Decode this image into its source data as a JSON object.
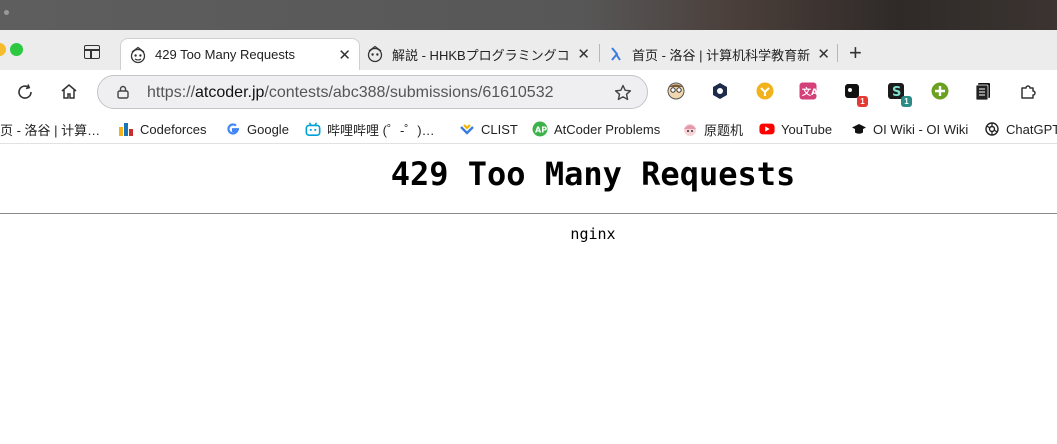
{
  "browser": {
    "tabs": [
      {
        "title": "429 Too Many Requests",
        "active": true,
        "favicon": "atcoder-icon"
      },
      {
        "title": "解説 - HHKBプログラミングコ",
        "active": false,
        "favicon": "atcoder-icon"
      },
      {
        "title": "首页 - 洛谷 | 计算机科学教育新",
        "active": false,
        "favicon": "luogu-icon"
      }
    ],
    "close_glyph": "✕",
    "newtab_glyph": "+",
    "url": {
      "scheme": "https://",
      "host": "atcoder.jp",
      "path": "/contests/abc388/submissions/61610532"
    },
    "extensions": [
      {
        "name": "ext-face-icon",
        "badge": ""
      },
      {
        "name": "ext-hex-icon",
        "badge": ""
      },
      {
        "name": "ext-coin-icon",
        "badge": ""
      },
      {
        "name": "ext-translate-icon",
        "badge": ""
      },
      {
        "name": "ext-tracker-icon",
        "badge": "1"
      },
      {
        "name": "ext-s-icon",
        "badge": "1"
      },
      {
        "name": "ext-plus-icon",
        "badge": ""
      },
      {
        "name": "ext-book-icon",
        "badge": ""
      },
      {
        "name": "extensions-puzzle-icon",
        "badge": ""
      }
    ],
    "bookmarks": [
      {
        "label": "页 - 洛谷 | 计算…",
        "icon": "luogu-icon"
      },
      {
        "label": "Codeforces",
        "icon": "codeforces-icon"
      },
      {
        "label": "Google",
        "icon": "google-icon"
      },
      {
        "label": "哔哩哔哩 (゜-゜)…",
        "icon": "bilibili-icon"
      },
      {
        "label": "CLIST",
        "icon": "clist-icon"
      },
      {
        "label": "AtCoder Problems",
        "icon": "atcoder-problems-icon"
      },
      {
        "label": "原题机",
        "icon": "anime-avatar-icon"
      },
      {
        "label": "YouTube",
        "icon": "youtube-icon"
      },
      {
        "label": "OI Wiki - OI Wiki",
        "icon": "graduation-cap-icon"
      },
      {
        "label": "ChatGPT",
        "icon": "chatgpt-icon"
      }
    ]
  },
  "page": {
    "heading": "429 Too Many Requests",
    "server": "nginx"
  },
  "colors": {
    "youtube": "#ff0000",
    "bilibili": "#00a1d6",
    "clist_blue": "#3b7ddd",
    "clist_yellow": "#f4b400",
    "atcoder_problems": "#3bb34a",
    "ext_plus": "#6aa121",
    "ext_badge_red": "#e53935",
    "ext_badge_teal": "#2a8c84"
  }
}
